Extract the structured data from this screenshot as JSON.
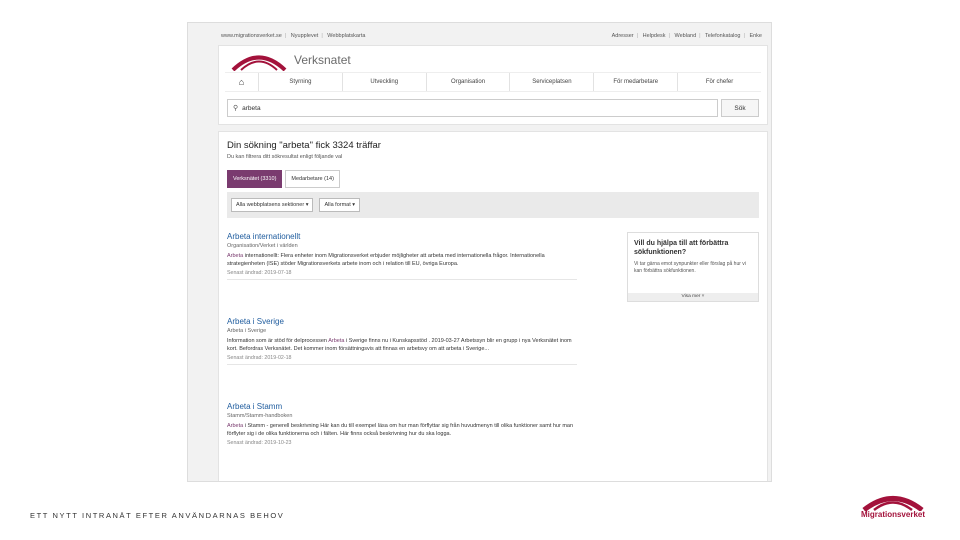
{
  "utility_left": [
    "www.migrationsverket.se",
    "Nyupplevet",
    "Webbplatskarta"
  ],
  "utility_right": [
    "Adresser",
    "Helpdesk",
    "Webland",
    "Telefonkatalog",
    "Enke"
  ],
  "brand": {
    "name": "Verksnatet"
  },
  "nav": {
    "home_icon": "home-icon",
    "items": [
      "Styrning",
      "Utveckling",
      "Organisation",
      "Serviceplatsen",
      "För medarbetare",
      "För chefer"
    ]
  },
  "search": {
    "value": "arbeta",
    "button": "Sök",
    "icon": "search-icon"
  },
  "results": {
    "title": "Din sökning \"arbeta\" fick 3324 träffar",
    "subtitle": "Du kan filtrera ditt sökresultat enligt följande val",
    "tabs": [
      "Verksnätet (3310)",
      "Medarbetare (14)"
    ],
    "filter_section": "Alla webbplatsens sektioner",
    "filter_format": "Alla format"
  },
  "hits": [
    {
      "title": "Arbeta internationellt",
      "path": "Organisation/Verket i världen",
      "text_pre": "",
      "highlight": "Arbeta",
      "text_post": " internationellt: Flera enheter inom Migrationsverket erbjuder möjligheter att arbeta med internationella frågor. Internationella strategienheten (ISE) stöder Migrationsverkets arbete inom och i relation till EU, övriga Europa.",
      "date": "Senast ändrad: 2019-07-18"
    },
    {
      "title": "Arbeta i Sverige",
      "path": "Arbeta i Sverige",
      "text_pre": "Information som är stöd för delprocessen ",
      "highlight": "Arbeta",
      "text_post": " i Sverige finns nu i Kunskapsstöd . 2019-03-27 Arbetssyn blir en grupp i nya Verksnätet inom kort. Befordras Verksnätet. Det kommer inom försättningsvis att finnas en arbetsvy om att arbeta i Sverige...",
      "date": "Senast ändrad: 2019-02-18"
    },
    {
      "title": "Arbeta i Stamm",
      "path": "Stamm/Stamm-handboken",
      "text_pre": "",
      "highlight": "Arbeta",
      "text_post": " i Stamm - generell beskrivning Här kan du till exempel läsa om hur man förflyttar sig från huvudmenyn till olika funktioner samt hur man förflyter sig i de olika funktionerna och i fälten. Här finns också beskrivning hur du ska logga.",
      "date": "Senast ändrad: 2019-10-23"
    }
  ],
  "feedback": {
    "title": "Vill du hjälpa till att förbättra sökfunktionen?",
    "text": "Vi tar gärna emot synpunkter eller förslag på hur vi kan förbättra sökfunktionen.",
    "more": "Visa mer ˅"
  },
  "footer": {
    "text": "ETT NYTT INTRANÄT EFTER ANVÄNDARNAS BEHOV",
    "logo_text": "Migrationsverket"
  },
  "colors": {
    "brand": "#a3123b",
    "accent": "#7a3b6f",
    "link": "#1f5c9e"
  }
}
